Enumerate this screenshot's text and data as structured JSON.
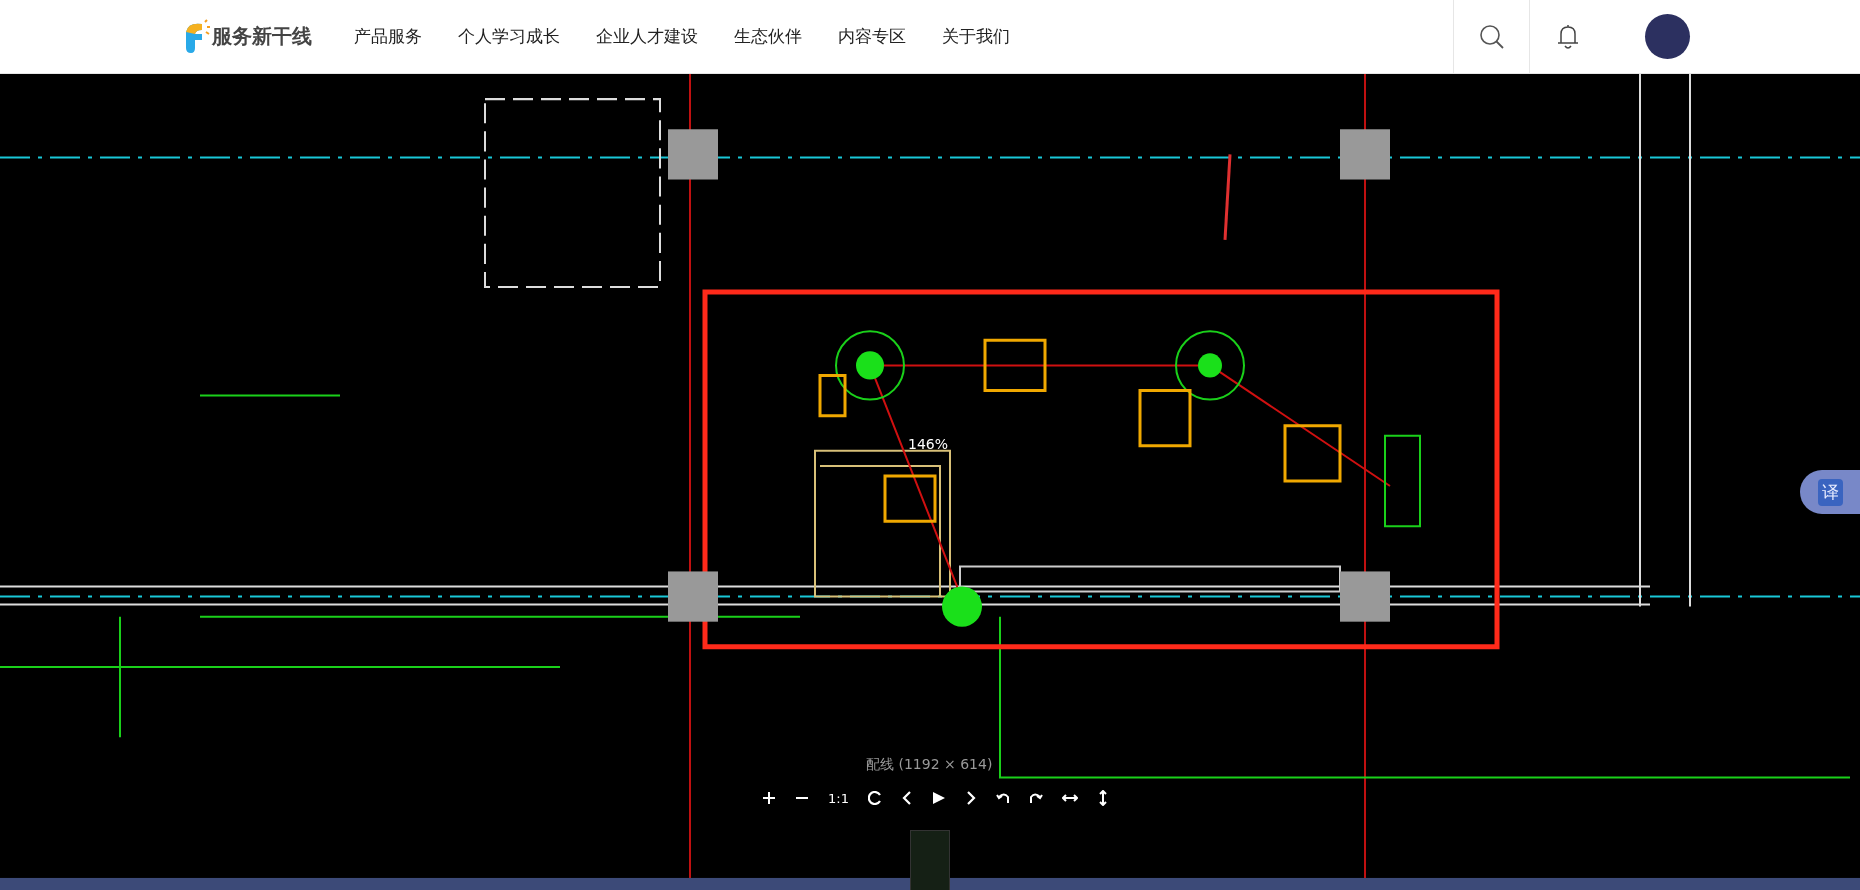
{
  "header": {
    "logo": "服务新干线",
    "nav": [
      {
        "label": "产品服务"
      },
      {
        "label": "个人学习成长"
      },
      {
        "label": "企业人才建设"
      },
      {
        "label": "生态伙伴"
      },
      {
        "label": "内容专区"
      },
      {
        "label": "关于我们"
      }
    ]
  },
  "viewer": {
    "zoom": "146%",
    "caption": "配线 (1192 × 614)",
    "reset_label": "1:1"
  },
  "translate_button": "译"
}
